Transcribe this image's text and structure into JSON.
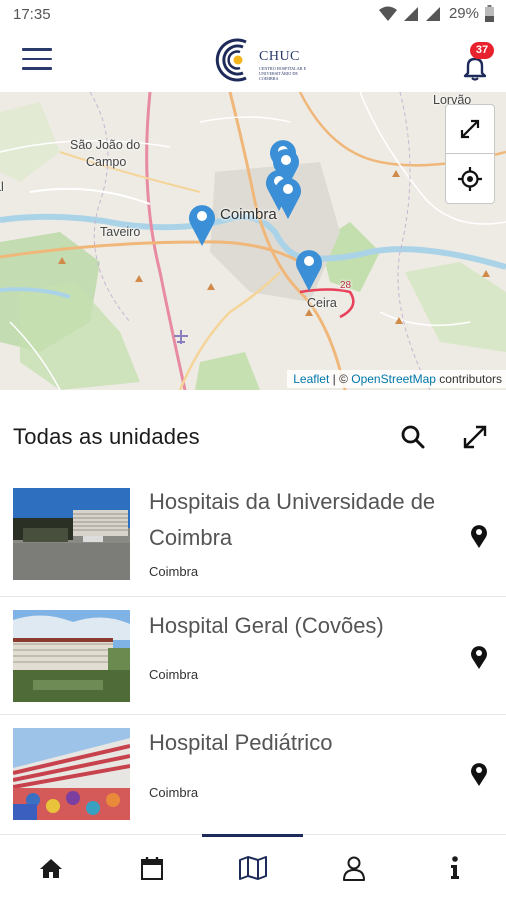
{
  "status_bar": {
    "time": "17:35",
    "battery": "29%"
  },
  "app_bar": {
    "logo_text": "CHUC",
    "logo_subtitle": "CENTRO HOSPITALAR E UNIVERSITÁRIO DE COIMBRA",
    "notification_count": "37"
  },
  "map": {
    "labels": {
      "lorvao": "Lorvão",
      "sao_joao_line1": "São João do",
      "sao_joao_line2": "Campo",
      "coimbra": "Coimbra",
      "taveiro": "Taveiro",
      "ceira": "Ceira",
      "road_number": "28",
      "edge_letter": "al"
    },
    "attribution": {
      "leaflet": "Leaflet",
      "separator": " | © ",
      "osm": "OpenStreetMap",
      "contributors": " contributors"
    },
    "accent_color": "#3b8fd6"
  },
  "list": {
    "title": "Todas as unidades",
    "items": [
      {
        "name": "Hospitais da Universidade de Coimbra",
        "city": "Coimbra"
      },
      {
        "name": "Hospital Geral (Covões)",
        "city": "Coimbra"
      },
      {
        "name": "Hospital Pediátrico",
        "city": "Coimbra"
      }
    ]
  },
  "bottom_nav": {
    "items": [
      {
        "icon": "home-icon"
      },
      {
        "icon": "calendar-icon"
      },
      {
        "icon": "map-icon",
        "active": true
      },
      {
        "icon": "user-icon"
      },
      {
        "icon": "info-icon"
      }
    ]
  },
  "colors": {
    "brand": "#1e2b5a",
    "badge": "#e8222d"
  }
}
